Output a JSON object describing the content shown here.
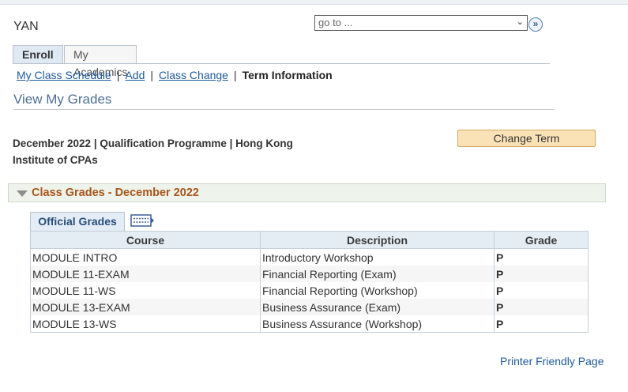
{
  "header": {
    "user_name": "YAN",
    "goto_placeholder": "go to ...",
    "go_button": "»"
  },
  "tabs": [
    {
      "label": "Enroll",
      "active": true
    },
    {
      "label": "My Academics",
      "active": false
    }
  ],
  "subnav": {
    "items": [
      "My Class Schedule",
      "Add",
      "Class Change"
    ],
    "current": "Term Information",
    "separator": "|"
  },
  "page_title": "View My Grades",
  "term": {
    "line1": "December 2022 | Qualification Programme | Hong Kong",
    "line2": "Institute of CPAs"
  },
  "change_term_label": "Change Term",
  "section": {
    "title": "Class Grades - December 2022"
  },
  "grades_tab_label": "Official Grades",
  "grid": {
    "columns": [
      "Course",
      "Description",
      "Grade"
    ],
    "rows": [
      [
        "MODULE INTRO",
        "Introductory Workshop",
        "P"
      ],
      [
        "MODULE 11-EXAM",
        "Financial Reporting (Exam)",
        "P"
      ],
      [
        "MODULE 11-WS",
        "Financial Reporting (Workshop)",
        "P"
      ],
      [
        "MODULE 13-EXAM",
        "Business Assurance (Exam)",
        "P"
      ],
      [
        "MODULE 13-WS",
        "Business Assurance (Workshop)",
        "P"
      ]
    ]
  },
  "printer_link": "Printer Friendly Page",
  "icons": {
    "go": "double-chevron-right-icon",
    "collapse": "triangle-down-icon",
    "grid_view": "grid-view-icon"
  }
}
